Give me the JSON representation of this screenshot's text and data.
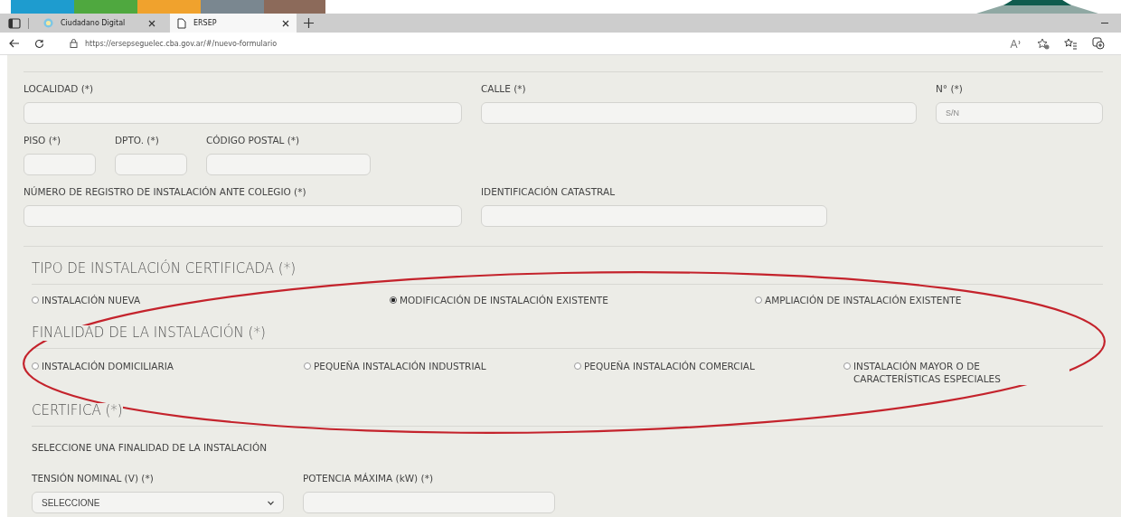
{
  "browser": {
    "tabs": [
      {
        "title": "Ciudadano Digital",
        "selected": false
      },
      {
        "title": "ERSEP",
        "selected": true
      }
    ],
    "url": "https://ersepseguelec.cba.gov.ar/#/nuevo-formulario"
  },
  "form": {
    "rows": [
      [
        {
          "label": "LOCALIDAD (*)"
        },
        {
          "label": "CALLE (*)"
        },
        {
          "label": "N° (*)",
          "placeholder": "S/N"
        }
      ],
      [
        {
          "label": "PISO (*)"
        },
        {
          "label": "DPTO. (*)"
        },
        {
          "label": "CÓDIGO POSTAL (*)"
        }
      ],
      [
        {
          "label": "NÚMERO DE REGISTRO DE INSTALACIÓN ANTE COLEGIO (*)"
        },
        {
          "label": "IDENTIFICACIÓN CATASTRAL"
        }
      ]
    ]
  },
  "tipo": {
    "title": "TIPO DE INSTALACIÓN CERTIFICADA (*)",
    "options": [
      {
        "label": "INSTALACIÓN NUEVA",
        "selected": false
      },
      {
        "label": "MODIFICACIÓN DE INSTALACIÓN EXISTENTE",
        "selected": true
      },
      {
        "label": "AMPLIACIÓN DE INSTALACIÓN EXISTENTE",
        "selected": false
      }
    ]
  },
  "finalidad": {
    "title": "FINALIDAD DE LA INSTALACIÓN (*)",
    "options": [
      {
        "label": "INSTALACIÓN DOMICILIARIA",
        "selected": false
      },
      {
        "label": "PEQUEÑA INSTALACIÓN INDUSTRIAL",
        "selected": false
      },
      {
        "label": "PEQUEÑA INSTALACIÓN COMERCIAL",
        "selected": false
      },
      {
        "label": "INSTALACIÓN MAYOR O DE CARACTERÍSTICAS ESPECIALES",
        "selected": false
      }
    ]
  },
  "certifica": {
    "title": "CERTIFICA (*)",
    "note": "SELECCIONE UNA FINALIDAD DE LA INSTALACIÓN",
    "fields": [
      {
        "label": "TENSIÓN NOMINAL (V) (*)",
        "kind": "select",
        "value": "SELECCIONE"
      },
      {
        "label": "POTENCIA MÁXIMA (kW) (*)",
        "kind": "input"
      }
    ]
  }
}
